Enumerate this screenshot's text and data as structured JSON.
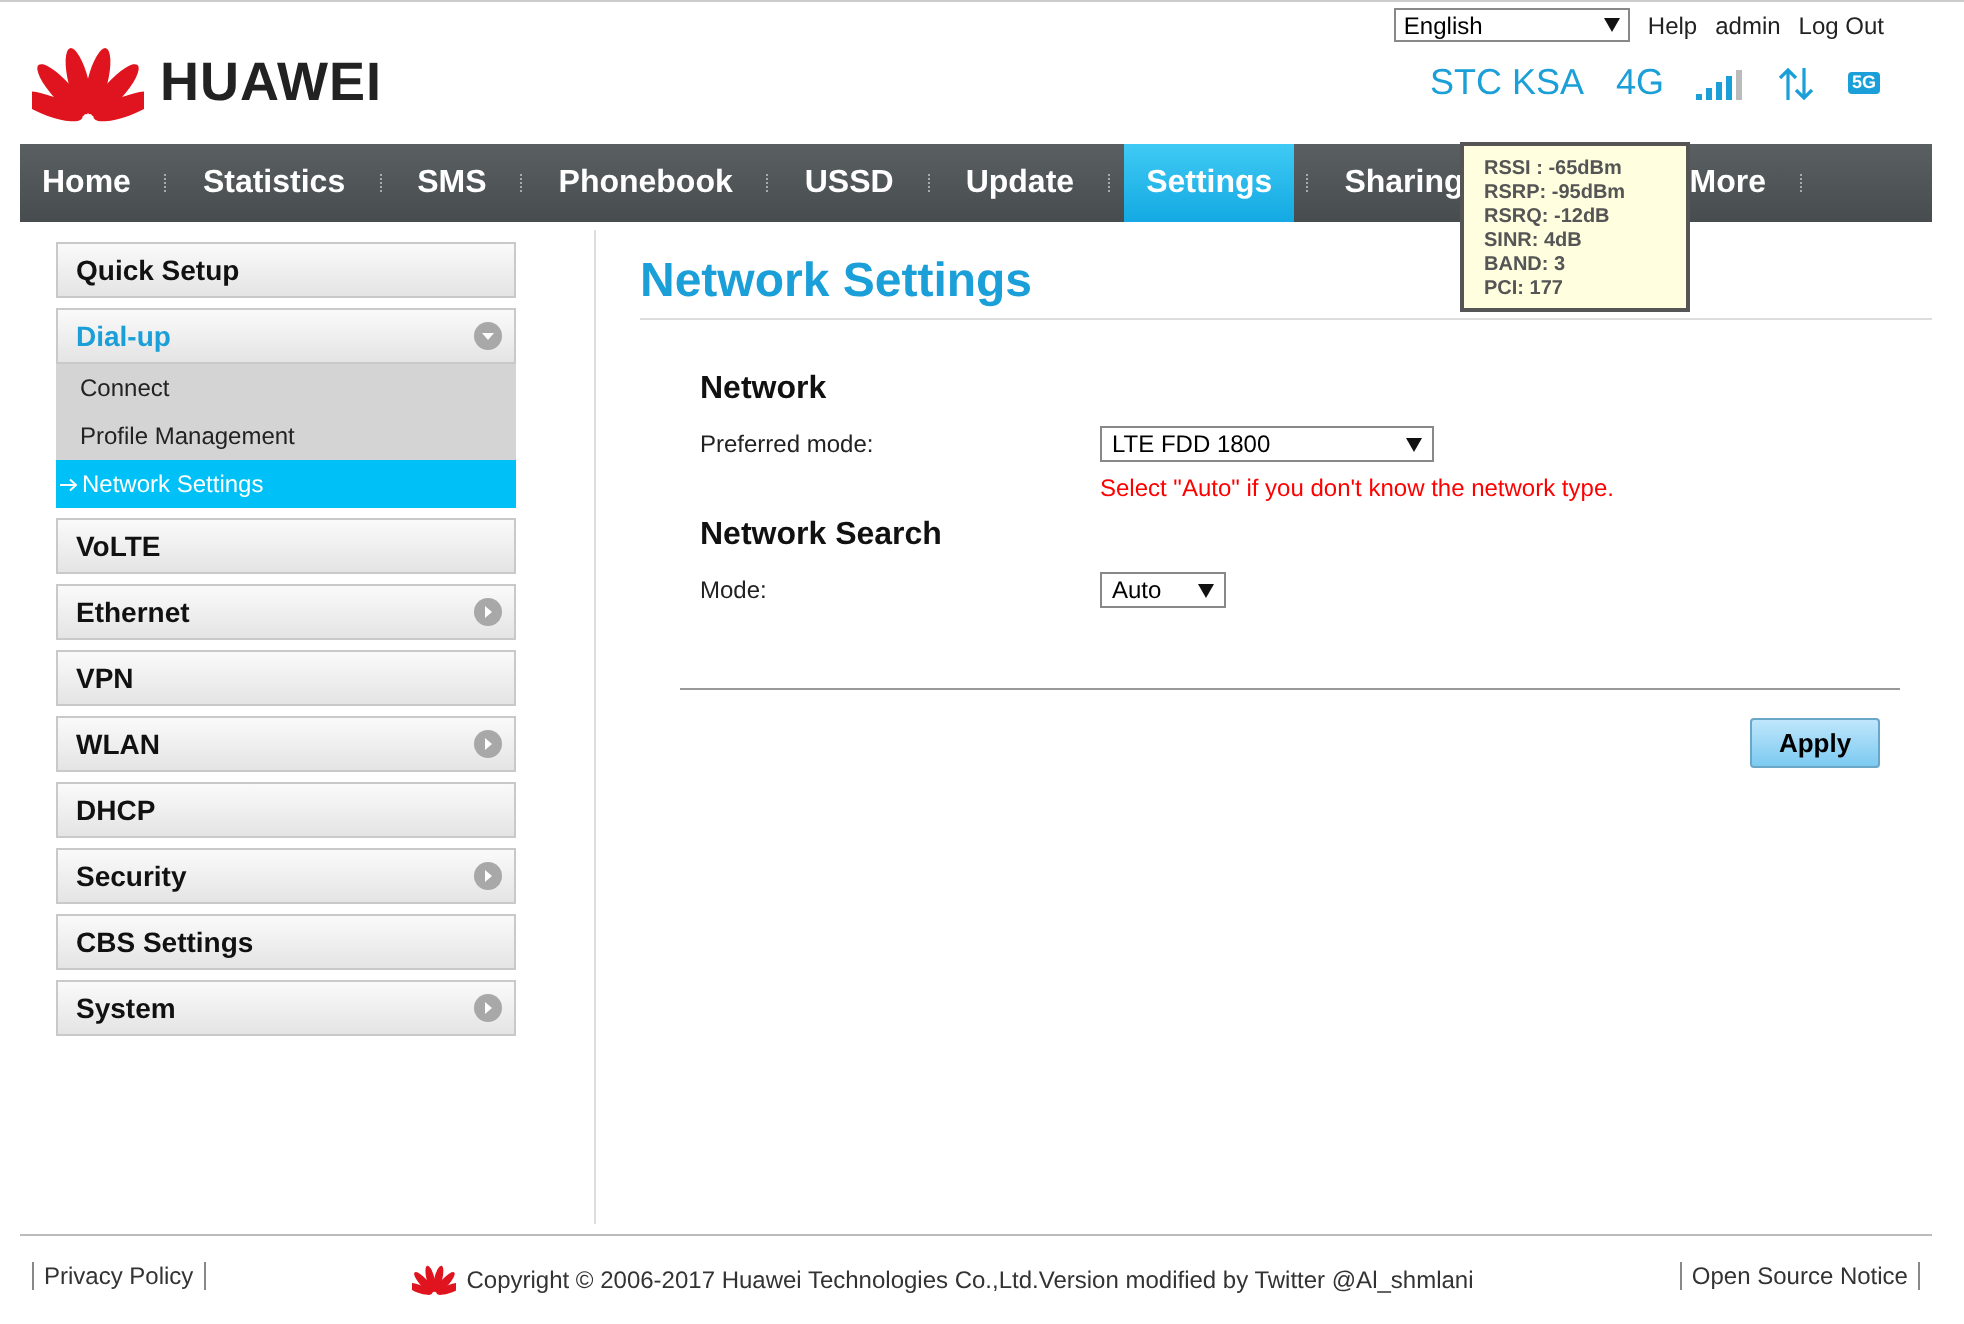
{
  "header": {
    "language": "English",
    "links": [
      "Help",
      "admin",
      "Log Out"
    ],
    "logo_text": "HUAWEI",
    "operator": "STC KSA",
    "network_type": "4G",
    "wifi_badge": "5G"
  },
  "signal_tooltip": [
    "RSSI : -65dBm",
    "RSRP: -95dBm",
    "RSRQ: -12dB",
    "SINR: 4dB",
    "BAND: 3",
    "PCI: 177"
  ],
  "nav": [
    {
      "label": "Home",
      "selected": false
    },
    {
      "label": "Statistics",
      "selected": false
    },
    {
      "label": "SMS",
      "selected": false
    },
    {
      "label": "Phonebook",
      "selected": false
    },
    {
      "label": "USSD",
      "selected": false
    },
    {
      "label": "Update",
      "selected": false
    },
    {
      "label": "Settings",
      "selected": true
    },
    {
      "label": "Sharing",
      "selected": false
    },
    {
      "label": "More",
      "selected": false
    }
  ],
  "sidebar": [
    {
      "label": "Quick Setup",
      "kind": "plain"
    },
    {
      "label": "Dial-up",
      "kind": "expandable",
      "expanded": true,
      "children": [
        {
          "label": "Connect",
          "selected": false
        },
        {
          "label": "Profile Management",
          "selected": false
        },
        {
          "label": "Network Settings",
          "selected": true
        }
      ]
    },
    {
      "label": "VoLTE",
      "kind": "plain"
    },
    {
      "label": "Ethernet",
      "kind": "expandable",
      "expanded": false
    },
    {
      "label": "VPN",
      "kind": "plain"
    },
    {
      "label": "WLAN",
      "kind": "expandable",
      "expanded": false
    },
    {
      "label": "DHCP",
      "kind": "plain"
    },
    {
      "label": "Security",
      "kind": "expandable",
      "expanded": false
    },
    {
      "label": "CBS Settings",
      "kind": "plain"
    },
    {
      "label": "System",
      "kind": "expandable",
      "expanded": false
    }
  ],
  "content": {
    "title": "Network Settings",
    "sections": [
      {
        "heading": "Network",
        "fields": [
          {
            "label": "Preferred mode:",
            "value": "LTE FDD 1800",
            "hint": "Select \"Auto\" if you don't know the network type.",
            "wide": true
          }
        ]
      },
      {
        "heading": "Network Search",
        "fields": [
          {
            "label": "Mode:",
            "value": "Auto",
            "wide": false
          }
        ]
      }
    ],
    "apply": "Apply"
  },
  "footer": {
    "privacy": "Privacy Policy",
    "copyright": "Copyright © 2006-2017 Huawei Technologies Co.,Ltd.Version modified by Twitter @Al_shmlani",
    "open_source": "Open Source Notice"
  }
}
